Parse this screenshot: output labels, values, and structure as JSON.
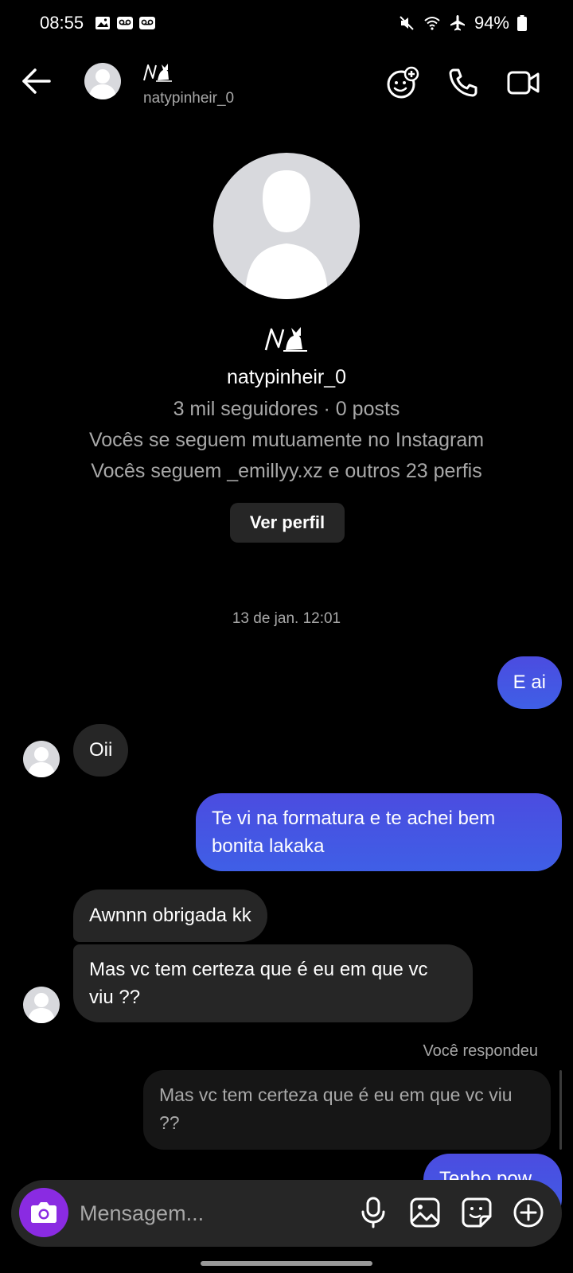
{
  "status_bar": {
    "time": "08:55",
    "battery": "94%",
    "icons": [
      "gallery-icon",
      "voicemail-icon",
      "voicemail-icon",
      "mute-icon",
      "wifi-icon",
      "airplane-icon",
      "battery-icon"
    ]
  },
  "header": {
    "username": "natypinheir_0",
    "actions": [
      "effects-icon",
      "phone-icon",
      "video-icon"
    ]
  },
  "profile": {
    "name": "natypinheir_0",
    "stats": "3 mil seguidores · 0 posts",
    "mutual": "Vocês se seguem mutuamente no Instagram",
    "follow_info": "Vocês seguem _emillyy.xz e outros 23 perfis",
    "view_button": "Ver perfil"
  },
  "chat": {
    "timestamp": "13 de jan. 12:01",
    "messages": [
      {
        "side": "sent",
        "text": "E ai"
      },
      {
        "side": "received",
        "text": "Oii"
      },
      {
        "side": "sent",
        "text": "Te vi na formatura e te achei bem bonita lakaka"
      },
      {
        "side": "received",
        "text": "Awnnn obrigada kk"
      },
      {
        "side": "received",
        "text": "Mas vc tem certeza que é eu em que vc viu ??"
      },
      {
        "side": "sent",
        "text": "Tenho pow"
      }
    ],
    "reply_label": "Você respondeu",
    "reply_quote": "Mas vc tem certeza que é eu em que vc viu ??"
  },
  "composer": {
    "placeholder": "Mensagem...",
    "icons": [
      "camera-icon",
      "microphone-icon",
      "gallery-icon",
      "sticker-icon",
      "plus-icon"
    ]
  },
  "colors": {
    "background": "#000000",
    "sent_bubble": "#4b4ce0",
    "received_bubble": "#262626",
    "camera_button": "#8a2be2",
    "secondary_text": "#a8a8a8"
  }
}
